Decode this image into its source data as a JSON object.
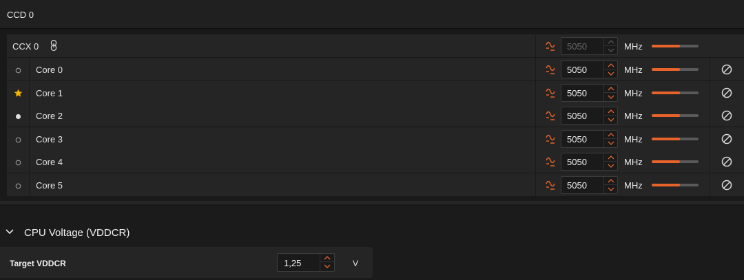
{
  "ccd": {
    "title": "CCD 0"
  },
  "ccx": {
    "label": "CCX 0",
    "frequency": "5050",
    "unit": "MHz",
    "slider_fraction": 0.6
  },
  "cores": [
    {
      "label": "Core 0",
      "status": "empty-circle",
      "frequency": "5050",
      "unit": "MHz",
      "slider_fraction": 0.6
    },
    {
      "label": "Core 1",
      "status": "star",
      "frequency": "5050",
      "unit": "MHz",
      "slider_fraction": 0.6
    },
    {
      "label": "Core 2",
      "status": "filled-dot",
      "frequency": "5050",
      "unit": "MHz",
      "slider_fraction": 0.6
    },
    {
      "label": "Core 3",
      "status": "empty-circle",
      "frequency": "5050",
      "unit": "MHz",
      "slider_fraction": 0.6
    },
    {
      "label": "Core 4",
      "status": "empty-circle",
      "frequency": "5050",
      "unit": "MHz",
      "slider_fraction": 0.6
    },
    {
      "label": "Core 5",
      "status": "empty-circle",
      "frequency": "5050",
      "unit": "MHz",
      "slider_fraction": 0.6
    }
  ],
  "voltage_section": {
    "title": "CPU Voltage (VDDCR)",
    "target_label": "Target VDDCR",
    "target_value": "1,25",
    "unit": "V"
  },
  "colors": {
    "accent": "#e8632b",
    "star": "#f4b400",
    "background": "#1b1b1b",
    "row": "#252525"
  }
}
